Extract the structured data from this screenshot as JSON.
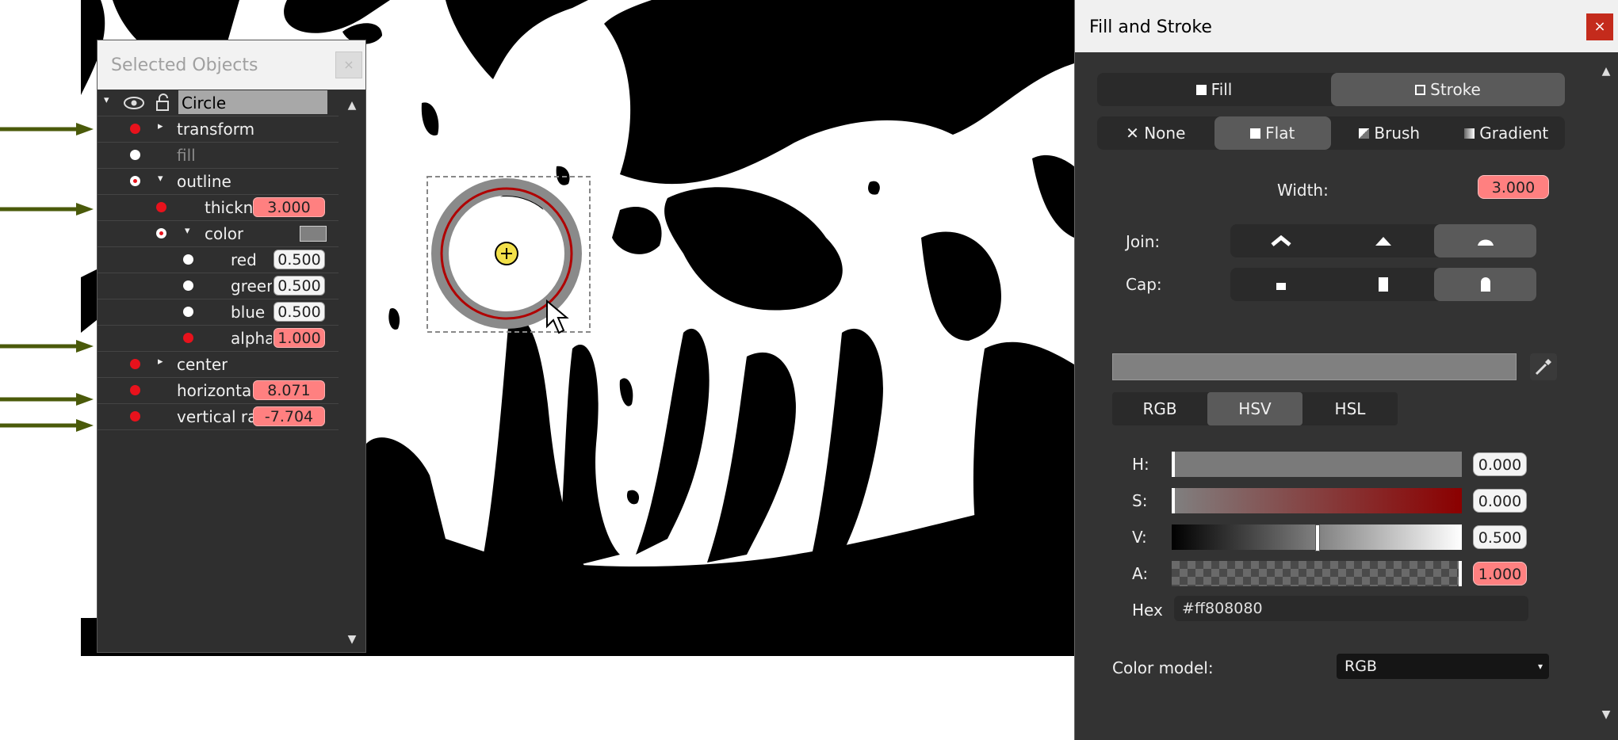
{
  "selected_objects": {
    "title": "Selected Objects",
    "close_label": "×",
    "scroll_up": "▲",
    "scroll_down": "▼",
    "header": {
      "expander": "▾",
      "eye_icon": "eye-icon",
      "lock_icon": "lock-open-icon",
      "name": "Circle"
    },
    "rows": {
      "transform": {
        "label": "transform",
        "expander": "▸"
      },
      "fill": {
        "label": "fill"
      },
      "outline": {
        "label": "outline",
        "expander": "▾"
      },
      "thickness": {
        "label": "thickne",
        "value": "3.000"
      },
      "color": {
        "label": "color",
        "expander": "▾",
        "swatch": "#808080"
      },
      "red": {
        "label": "red",
        "value": "0.500"
      },
      "green": {
        "label": "green",
        "value": "0.500"
      },
      "blue": {
        "label": "blue",
        "value": "0.500"
      },
      "alpha": {
        "label": "alpha",
        "value": "1.000"
      },
      "center": {
        "label": "center",
        "expander": "▸"
      },
      "horizontal": {
        "label": "horizonta",
        "value": "8.071"
      },
      "vertical": {
        "label": "vertical ra",
        "value": "-7.704"
      }
    }
  },
  "fill_stroke": {
    "title": "Fill and Stroke",
    "close_label": "×",
    "scroll_up": "▲",
    "scroll_down": "▼",
    "tabs": {
      "fill": "Fill",
      "stroke": "Stroke",
      "active": "stroke"
    },
    "paint_modes": {
      "none": "None",
      "flat": "Flat",
      "brush": "Brush",
      "gradient": "Gradient",
      "active": "flat"
    },
    "width_label": "Width:",
    "width_value": "3.000",
    "join_label": "Join:",
    "cap_label": "Cap:",
    "join_active": "round",
    "cap_active": "round",
    "color_models_tabs": {
      "rgb": "RGB",
      "hsv": "HSV",
      "hsl": "HSL",
      "active": "hsv"
    },
    "sliders": {
      "h": {
        "label": "H:",
        "value": "0.000"
      },
      "s": {
        "label": "S:",
        "value": "0.000"
      },
      "v": {
        "label": "V:",
        "value": "0.500"
      },
      "a": {
        "label": "A:",
        "value": "1.000"
      }
    },
    "hex_label": "Hex",
    "hex_value": "#ff808080",
    "color_model_label": "Color model:",
    "color_model_value": "RGB",
    "dropdown_caret": "▾",
    "preview_color": "#808080",
    "eyedropper_icon": "eyedropper-icon"
  },
  "colors": {
    "accent_red": "#ff8080",
    "dot_red": "#e8121c",
    "arrow_green": "#4a5a0a",
    "stroke_red": "#b00000"
  }
}
